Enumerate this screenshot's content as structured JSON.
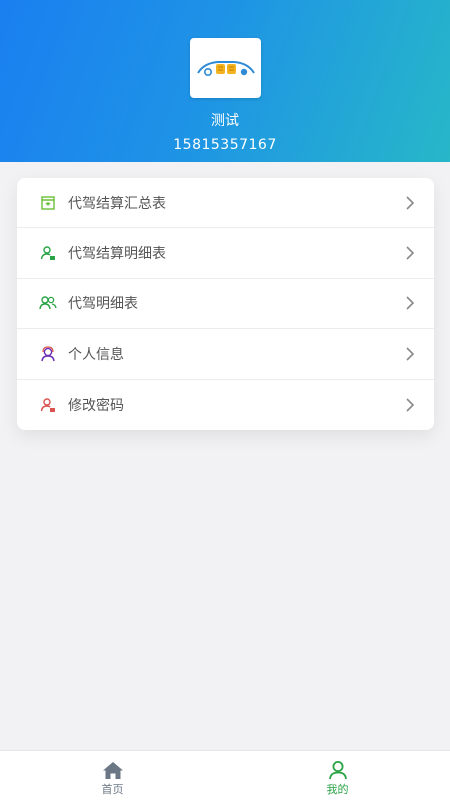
{
  "header": {
    "logo_icon": "car-logo-icon",
    "user_name": "测试",
    "phone": "15815357167",
    "gradient_start": "#1a7ff0",
    "gradient_end": "#27b7c8"
  },
  "menu": {
    "items": [
      {
        "label": "代驾结算汇总表",
        "icon": "summary-report-icon",
        "color": "#6bbf3a"
      },
      {
        "label": "代驾结算明细表",
        "icon": "user-detail-icon",
        "color": "#2aa345"
      },
      {
        "label": "代驾明细表",
        "icon": "users-icon",
        "color": "#2aa345"
      },
      {
        "label": "个人信息",
        "icon": "user-info-icon",
        "color": "#6b2fb3"
      },
      {
        "label": "修改密码",
        "icon": "user-password-icon",
        "color": "#d9534f"
      }
    ],
    "chevron_icon": "chevron-right-icon"
  },
  "tabbar": {
    "tabs": [
      {
        "label": "首页",
        "icon": "home-icon",
        "active": false
      },
      {
        "label": "我的",
        "icon": "profile-icon",
        "active": true
      }
    ],
    "active_color": "#2aa345",
    "inactive_color": "#6b7785"
  }
}
